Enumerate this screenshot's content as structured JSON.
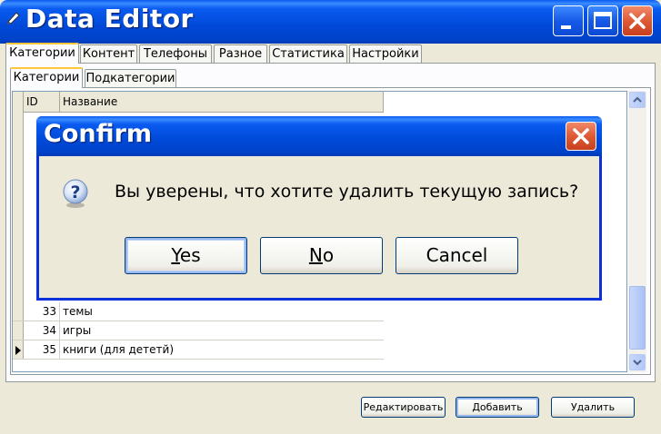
{
  "window": {
    "title": "Data Editor"
  },
  "tabs": [
    "Категории",
    "Контент",
    "Телефоны",
    "Разное",
    "Статистика",
    "Настройки"
  ],
  "subtabs": [
    "Категории",
    "Подкатегории"
  ],
  "grid": {
    "columns": [
      "ID",
      "Название"
    ],
    "rows": [
      {
        "id": "33",
        "name": "темы"
      },
      {
        "id": "34",
        "name": "игры"
      },
      {
        "id": "35",
        "name": "книги (для дететй)"
      }
    ]
  },
  "buttons": {
    "edit": "Редактировать",
    "add": "Добавить",
    "delete": "Удалить"
  },
  "dialog": {
    "title": "Confirm",
    "message": "Вы уверены, что хотите удалить текущую запись?",
    "yes_label": "Yes",
    "yes_mnemonic": "Y",
    "yes_rest": "es",
    "no_label": "No",
    "no_mnemonic": "N",
    "no_rest": "o",
    "cancel_label": "Cancel"
  },
  "colors": {
    "titlebar": "#0A5BF0",
    "dialog_border": "#0831D9",
    "face": "#ECE9D8"
  }
}
